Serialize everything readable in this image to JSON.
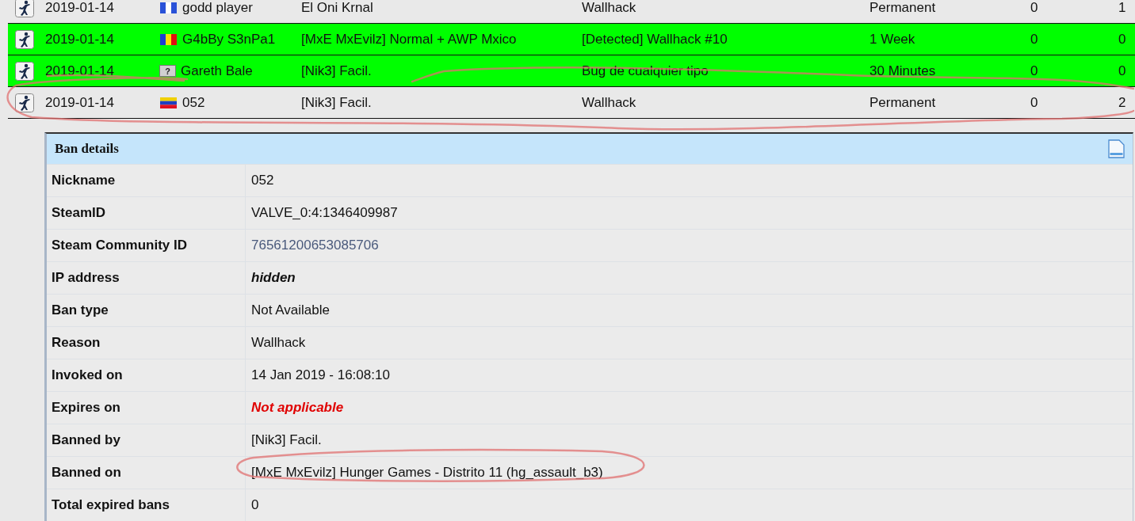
{
  "bans": [
    {
      "date": "2019-01-14",
      "flag": {
        "kind": "blue-white"
      },
      "nickname": "godd player",
      "admin": "El Oni Krnal",
      "reason": "Wallhack",
      "length": "Permanent",
      "column_7": "0",
      "column_8": "1",
      "highlighted": false
    },
    {
      "date": "2019-01-14",
      "flag": {
        "kind": "blue-yellow-red"
      },
      "nickname": "G4bBy S3nPa1",
      "admin": "[MxE MxEvilz] Normal + AWP Mxico",
      "reason": "[Detected] Wallhack #10",
      "length": "1 Week",
      "column_7": "0",
      "column_8": "0",
      "highlighted": true
    },
    {
      "date": "2019-01-14",
      "flag": {
        "kind": "unknown",
        "text": "?"
      },
      "nickname": "Gareth Bale",
      "admin": "[Nik3] Facil.",
      "reason": "Bug de cualquier tipo",
      "length": "30 Minutes",
      "column_7": "0",
      "column_8": "0",
      "highlighted": true
    },
    {
      "date": "2019-01-14",
      "flag": {
        "kind": "yellow-blue-red"
      },
      "nickname": "052",
      "admin": "[Nik3] Facil.",
      "reason": "Wallhack",
      "length": "Permanent",
      "column_7": "0",
      "column_8": "2",
      "highlighted": false
    }
  ],
  "details": {
    "title": "Ban details",
    "rows": [
      {
        "label": "Nickname",
        "value": "052",
        "kind": "text"
      },
      {
        "label": "SteamID",
        "value": "VALVE_0:4:1346409987",
        "kind": "text"
      },
      {
        "label": "Steam Community ID",
        "value": "76561200653085706",
        "kind": "link"
      },
      {
        "label": "IP address",
        "value": "hidden",
        "kind": "emphasis"
      },
      {
        "label": "Ban type",
        "value": "Not Available",
        "kind": "text"
      },
      {
        "label": "Reason",
        "value": "Wallhack",
        "kind": "text"
      },
      {
        "label": "Invoked on",
        "value": "14 Jan 2019 - 16:08:10",
        "kind": "text"
      },
      {
        "label": "Expires on",
        "value": "Not applicable",
        "kind": "warning"
      },
      {
        "label": "Banned by",
        "value": "[Nik3] Facil.",
        "kind": "text"
      },
      {
        "label": "Banned on",
        "value": "[MxE MxEvilz] Hunger Games - Distrito 11 (hg_assault_b3)",
        "kind": "text"
      },
      {
        "label": "Total expired bans",
        "value": "0",
        "kind": "text"
      }
    ]
  }
}
